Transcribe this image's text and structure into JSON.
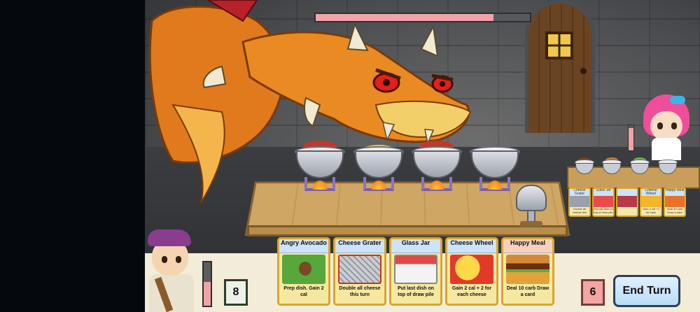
{
  "boss": {
    "hp_fraction": 0.83
  },
  "opponent": {
    "hp_fraction": 0.9,
    "hand": [
      {
        "name": "Cheese Grater",
        "text": "Double all cheese this turn"
      },
      {
        "name": "Glass Jar",
        "text": "Put last dish on top of draw pile"
      },
      {
        "name": "",
        "text": ""
      },
      {
        "name": "Cheese Wheel",
        "text": "Gain 2 cal +2 for each cheese"
      },
      {
        "name": "Happy Meal",
        "text": "Deal 10 carb Draw a card"
      }
    ]
  },
  "player": {
    "hp_fraction": 0.55,
    "draw_pile_count": "8",
    "discard_pile_count": "6",
    "end_turn_label": "End Turn",
    "hand": [
      {
        "name": "Angry Avocado",
        "text": "Prep dish. Gain 2 cal"
      },
      {
        "name": "Cheese Grater",
        "text": "Double all cheese this turn"
      },
      {
        "name": "Glass Jar",
        "text": "Put last dish on top of draw pile"
      },
      {
        "name": "Cheese Wheel",
        "text": "Gain 2 cal + 2 for each cheese"
      },
      {
        "name": "Happy Meal",
        "text": "Deal 10 carb Draw a card"
      }
    ]
  },
  "colors": {
    "health_fill": "#f0a3a8",
    "card_border": "#d9a62b",
    "end_turn_bg": "#cfe6fa"
  },
  "icons": [
    "dragon-boss",
    "chef-girl-opponent",
    "chef-boy-player",
    "cooking-pot",
    "meat-grinder"
  ]
}
